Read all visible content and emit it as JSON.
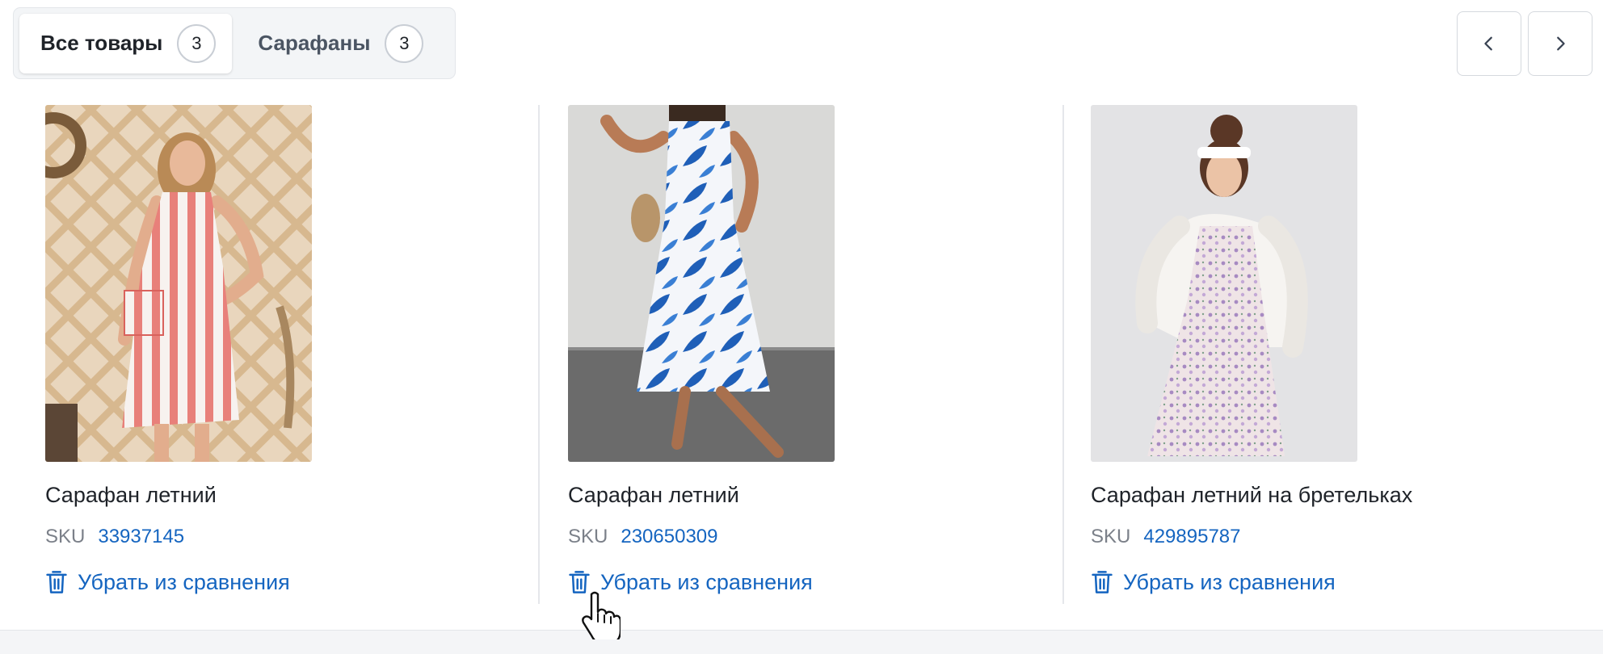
{
  "tabs": [
    {
      "label": "Все товары",
      "count": "3",
      "active": true
    },
    {
      "label": "Сарафаны",
      "count": "3",
      "active": false
    }
  ],
  "nav": {
    "prev_icon": "chevron-left-icon",
    "next_icon": "chevron-right-icon"
  },
  "products": [
    {
      "title": "Сарафан летний",
      "sku_label": "SKU",
      "sku": "33937145",
      "remove_label": "Убрать из сравнения"
    },
    {
      "title": "Сарафан летний",
      "sku_label": "SKU",
      "sku": "230650309",
      "remove_label": "Убрать из сравнения"
    },
    {
      "title": "Сарафан летний на бретельках",
      "sku_label": "SKU",
      "sku": "429895787",
      "remove_label": "Убрать из сравнения"
    }
  ],
  "colors": {
    "accent": "#1565c0",
    "text": "#1f2329",
    "muted": "#7b8089"
  }
}
